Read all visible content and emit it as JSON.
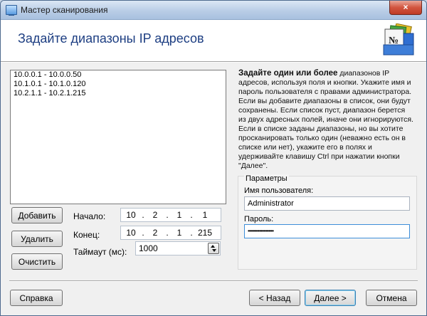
{
  "window": {
    "title": "Мастер сканирования",
    "close_glyph": "×"
  },
  "header": {
    "heading": "Задайте диапазоны IP адресов",
    "logo_icon": "folder-document-icon",
    "logo_text": "№"
  },
  "ranges": [
    "10.0.0.1 - 10.0.0.50",
    "10.1.0.1 - 10.1.0.120",
    "10.2.1.1 - 10.2.1.215"
  ],
  "buttons": {
    "add": "Добавить",
    "delete": "Удалить",
    "clear": "Очистить",
    "help": "Справка",
    "back": "< Назад",
    "next": "Далее >",
    "cancel": "Отмена"
  },
  "fields": {
    "start_label": "Начало:",
    "end_label": "Конец:",
    "timeout_label": "Таймаут (мс):",
    "start_octets": [
      "10",
      "2",
      "1",
      "1"
    ],
    "end_octets": [
      "10",
      "2",
      "1",
      "215"
    ],
    "timeout_value": "1000"
  },
  "description": {
    "bold": "Задайте один или более",
    "text": "диапазонов IP адресов, используя поля и кнопки. Укажите имя и пароль пользователя с правами администратора. Если вы добавите диапазоны в список, они будут сохранены. Если список пуст, диапазон берется из двух адресных полей, иначе они игнорируются. Если в списке заданы диапазоны, но вы хотите просканировать только один (неважно есть он в списке или нет), укажите его в полях и удерживайте клавишу Ctrl при нажатии кнопки \"Далее\"."
  },
  "params": {
    "legend": "Параметры",
    "user_label": "Имя пользователя:",
    "user_value": "Administrator",
    "password_label": "Пароль:",
    "password_value": "••••••••••••••••••••"
  },
  "colors": {
    "heading": "#1d3e82",
    "close": "#c7432b",
    "focus": "#3c7fb1"
  }
}
